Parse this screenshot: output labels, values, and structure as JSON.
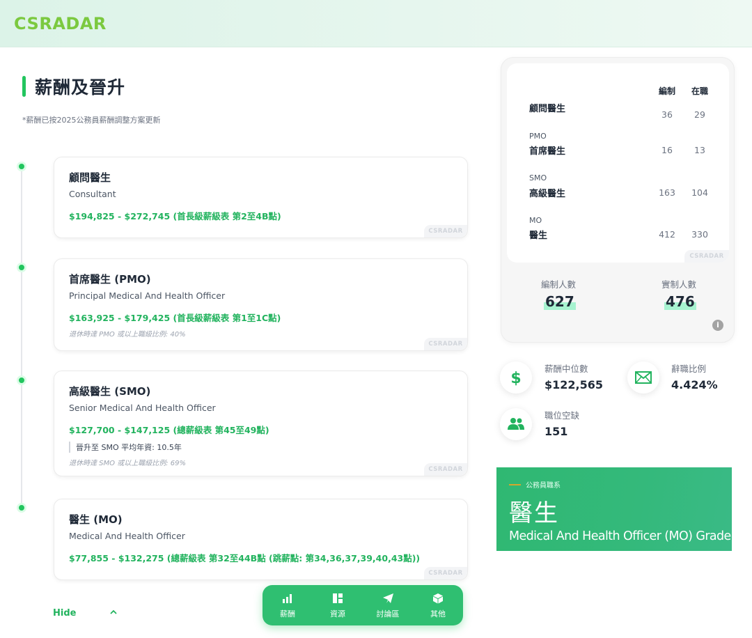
{
  "header": {
    "logo_text": "CSRADAR"
  },
  "page": {
    "title": "薪酬及晉升",
    "note": "*薪酬已按2025公務員薪酬調整方案更新"
  },
  "ranks": [
    {
      "title": "顧問醫生",
      "english": "Consultant",
      "salary": "$194,825 - $272,745 (首長級薪級表 第2至4B點)",
      "watermark": "CSRADAR"
    },
    {
      "title": "首席醫生 (PMO)",
      "english": "Principal Medical And Health Officer",
      "salary": "$163,925 - $179,425 (首長級薪級表 第1至1C點)",
      "retire_note": "退休時達 PMO 或以上職級比例: 40%",
      "watermark": "CSRADAR"
    },
    {
      "title": "高級醫生 (SMO)",
      "english": "Senior Medical And Health Officer",
      "salary": "$127,700 - $147,125 (總薪級表 第45至49點)",
      "promotion": "晉升至 SMO 平均年資: 10.5年",
      "retire_note": "退休時達 SMO 或以上職級比例: 69%",
      "watermark": "CSRADAR"
    },
    {
      "title": "醫生 (MO)",
      "english": "Medical And Health Officer",
      "salary": "$77,855 - $132,275 (總薪級表 第32至44B點 (跳薪點: 第34,36,37,39,40,43點))",
      "watermark": "CSRADAR"
    }
  ],
  "toggle": {
    "label": "Hide",
    "icon": "chevron-up-icon"
  },
  "bottom_nav": [
    {
      "label": "薪酬",
      "icon": "bar-chart-icon"
    },
    {
      "label": "資源",
      "icon": "grid-icon"
    },
    {
      "label": "討論區",
      "icon": "paper-plane-icon"
    },
    {
      "label": "其他",
      "icon": "cube-icon"
    }
  ],
  "establishment": {
    "headers": {
      "establishment": "編制",
      "strength": "在職"
    },
    "rows": [
      {
        "abbr": "",
        "name": "顧問醫生",
        "establishment": "36",
        "strength": "29"
      },
      {
        "abbr": "PMO",
        "name": "首席醫生",
        "establishment": "16",
        "strength": "13"
      },
      {
        "abbr": "SMO",
        "name": "高級醫生",
        "establishment": "163",
        "strength": "104"
      },
      {
        "abbr": "MO",
        "name": "醫生",
        "establishment": "412",
        "strength": "330"
      }
    ],
    "watermark": "CSRADAR",
    "totals": {
      "establishment_label": "編制人數",
      "establishment_value": "627",
      "strength_label": "實制人數",
      "strength_value": "476"
    },
    "info_icon": "info-icon"
  },
  "kpis": {
    "median_salary": {
      "label": "薪酬中位數",
      "value": "$122,565",
      "icon": "dollar-icon"
    },
    "resignation_rate": {
      "label": "辭職比例",
      "value": "4.424%",
      "icon": "envelope-icon"
    },
    "vacancies": {
      "label": "職位空缺",
      "value": "151",
      "icon": "users-icon"
    }
  },
  "banner": {
    "caption": "公務員職系",
    "title": "醫生",
    "english": "Medical And Health Officer (MO) Grade"
  },
  "colors": {
    "accent": "#22b35e",
    "nav_bg": "#2fbf71",
    "banner_bg": "#34b97b",
    "logo": "#7bc93f"
  }
}
